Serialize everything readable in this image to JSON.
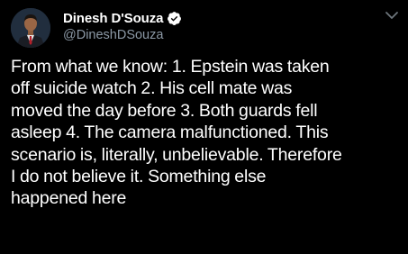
{
  "author": {
    "display_name": "Dinesh D'Souza",
    "handle": "@DineshDSouza",
    "verified": true,
    "avatar_icon": "profile-photo"
  },
  "menu": {
    "icon": "chevron-down-icon"
  },
  "tweet": {
    "lines": [
      "From what we know: 1. Epstein was taken",
      "off suicide watch 2. His cell mate was",
      "moved the day before 3. Both guards fell",
      "asleep 4. The camera malfunctioned. This",
      "scenario is, literally, unbelievable. Therefore",
      "I do not believe it. Something else",
      "happened here"
    ]
  },
  "colors": {
    "background": "#000000",
    "text": "#ffffff",
    "secondary_text": "#8b98a5",
    "verified_badge": "#ffffff"
  }
}
